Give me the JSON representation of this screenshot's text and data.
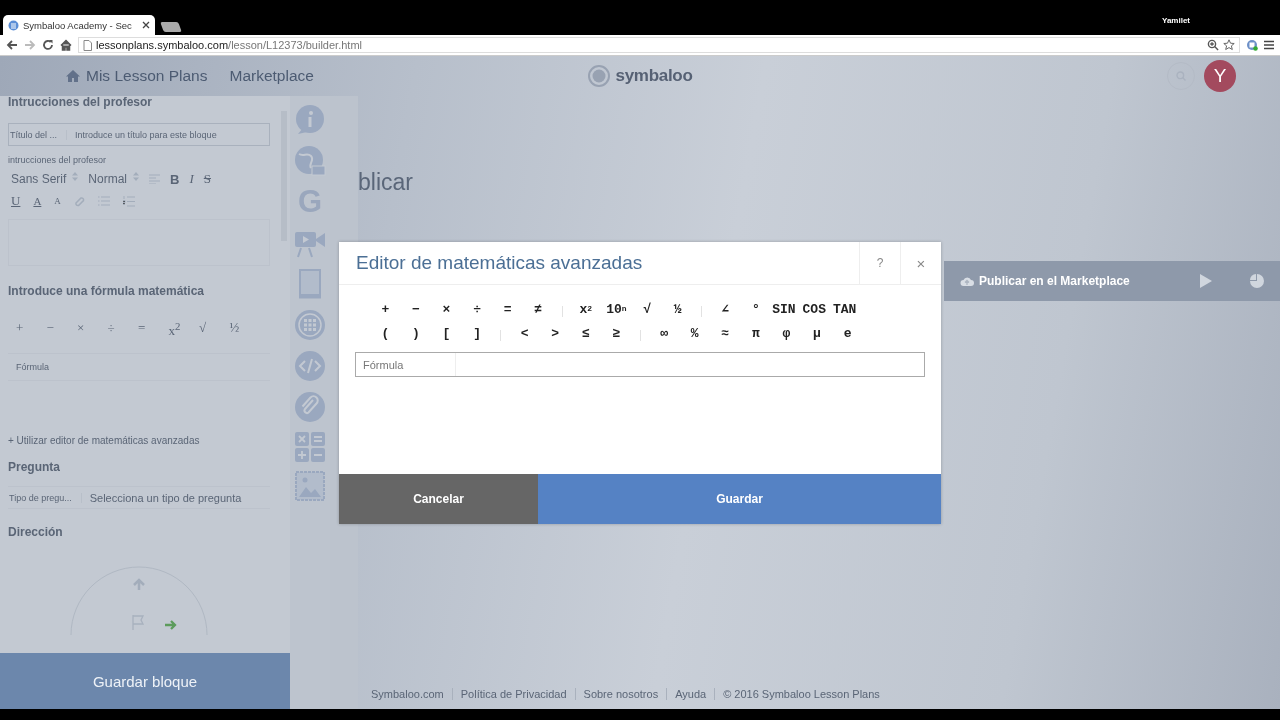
{
  "browser": {
    "tab": {
      "title": "Symbaloo Academy - Sec",
      "selected": true
    },
    "profile": "Yamilet",
    "url_host": "lessonplans.symbaloo.com",
    "url_path": "/lesson/L12373/builder.html"
  },
  "header": {
    "nav": [
      {
        "label": "Mis Lesson Plans",
        "kind": "home"
      },
      {
        "label": "Marketplace",
        "kind": "plain"
      }
    ],
    "logo": "symbaloo",
    "avatar": "Y"
  },
  "left_panel": {
    "section_title": "Intrucciones del profesor",
    "title_field": {
      "label": "Título del ...",
      "placeholder": "Introduce un título para este bloque"
    },
    "editor_label": "intrucciones del profesor",
    "font_select": "Sans Serif",
    "size_select": "Normal",
    "format_rows": [
      [
        {
          "kind": "align"
        },
        {
          "kind": "bold",
          "label": "B"
        },
        {
          "kind": "italic",
          "label": "I"
        },
        {
          "kind": "strike",
          "label": "S"
        }
      ],
      [
        {
          "kind": "underline",
          "label": "U"
        },
        {
          "kind": "color",
          "label": "A"
        },
        {
          "kind": "background",
          "label": "A"
        },
        {
          "kind": "link"
        },
        {
          "kind": "bullets"
        },
        {
          "kind": "numbers"
        }
      ]
    ],
    "formula_title": "Introduce una fórmula matemática",
    "formula_buttons": [
      "+",
      "−",
      "×",
      "÷",
      "=",
      "x$^{2}$",
      "√",
      "½"
    ],
    "formula_placeholder": "Fórmula",
    "advanced_link": "+ Utilizar editor de matemáticas avanzadas",
    "question_title": "Pregunta",
    "question_type": {
      "label": "Tipo de pregu...",
      "value": "Selecciona un tipo de pregunta"
    },
    "direction_title": "Dirección",
    "save_button": "Guardar bloque"
  },
  "tools": [
    {
      "kind": "info"
    },
    {
      "kind": "globe"
    },
    {
      "kind": "letter",
      "label": "G"
    },
    {
      "kind": "video"
    },
    {
      "kind": "book"
    },
    {
      "kind": "grid"
    },
    {
      "kind": "code"
    },
    {
      "kind": "clip"
    },
    {
      "kind": "math"
    },
    {
      "kind": "image"
    }
  ],
  "content": {
    "heading": "blicar",
    "publish_button": "Publicar en el Marketplace"
  },
  "footer": [
    "Symbaloo.com",
    "Política de Privacidad",
    "Sobre nosotros",
    "Ayuda",
    "© 2016 Symbaloo Lesson Plans"
  ],
  "modal": {
    "title": "Editor de matemáticas avanzadas",
    "help": "?",
    "close": "×",
    "toolbar_rows": [
      [
        [
          "+",
          "−",
          "×",
          "÷",
          "=",
          "≠"
        ],
        [
          "x$^{2}$",
          "10$^{n}$",
          "√",
          "½"
        ],
        [
          "∠",
          "°",
          "SIN",
          "COS",
          "TAN"
        ]
      ],
      [
        [
          "(",
          ")",
          "[",
          "]"
        ],
        [
          "<",
          ">",
          "≤",
          "≥"
        ],
        [
          "∞",
          "%",
          "≈",
          "π",
          "φ",
          "μ",
          "e"
        ]
      ]
    ],
    "formula_label": "Fórmula",
    "cancel": "Cancelar",
    "save": "Guardar"
  }
}
